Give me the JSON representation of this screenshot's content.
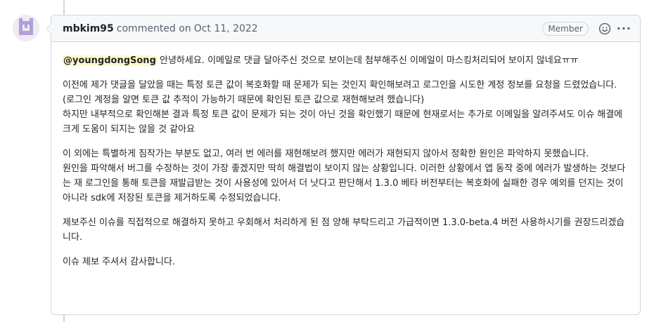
{
  "comment": {
    "author": "mbkim95",
    "action": "commented on",
    "date": "Oct 11, 2022",
    "badge": "Member",
    "emoji_icon": "smiley-icon",
    "more_icon": "kebab-horizontal-icon",
    "mention": "@youngdongSong",
    "paragraphs": {
      "p1_rest": " 안녕하세요. 이메일로 댓글 달아주신 것으로 보이는데 첨부해주신 이메일이 마스킹처리되어 보이지 않네요ㅠㅠ",
      "p2": "이전에 제가 댓글을 달았을 때는 특정 토큰 값이 복호화할 때 문제가 되는 것인지 확인해보려고 로그인을 시도한 계정 정보를 요청을 드렸었습니다. (로그인 계정을 알면 토큰 값 추적이 가능하기 때문에 확인된 토큰 값으로 재현해보려 했습니다)\n하지만 내부적으로 확인해본 결과 특정 토큰 값이 문제가 되는 것이 아닌 것을 확인했기 때문에 현재로서는 추가로 이메일을 알려주셔도 이슈 해결에 크게 도움이 되지는 않을 것 같아요",
      "p3": "이 외에는 특별하게 짐작가는 부분도 없고, 여러 번 에러를 재현해보려 했지만 에러가 재현되지 않아서 정확한 원인은 파악하지 못했습니다.\n원인을 파악해서 버그를 수정하는 것이 가장 좋겠지만 딱히 해결법이 보이지 않는 상황입니다. 이러한 상황에서 앱 동작 중에 에러가 발생하는 것보다는 재 로그인을 통해 토큰을 재발급받는 것이 사용성에 있어서 더 낫다고 판단해서 1.3.0 베타 버전부터는 복호화에 실패한 경우 예외를 던지는 것이 아니라 sdk에 저장된 토큰을 제거하도록 수정되었습니다.",
      "p4": "제보주신 이슈를 직접적으로 해결하지 못하고 우회해서 처리하게 된 점 양해 부탁드리고 가급적이면 1.3.0-beta.4 버전 사용하시기를 권장드리겠습니다.",
      "p5": "이슈 제보 주셔서 감사합니다."
    }
  }
}
